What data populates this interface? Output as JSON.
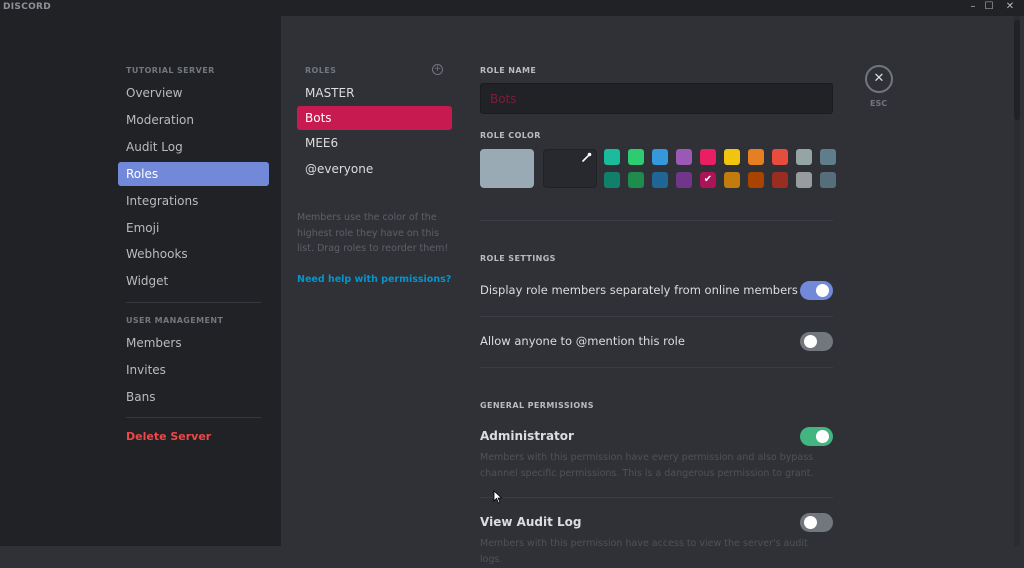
{
  "titlebar": {
    "app_name": "DISCORD",
    "minimize": "–",
    "maximize": "☐",
    "close": "✕"
  },
  "sidebar": {
    "server_header": "TUTORIAL SERVER",
    "server_items": [
      {
        "label": "Overview",
        "active": false
      },
      {
        "label": "Moderation",
        "active": false
      },
      {
        "label": "Audit Log",
        "active": false
      },
      {
        "label": "Roles",
        "active": true
      },
      {
        "label": "Integrations",
        "active": false
      },
      {
        "label": "Emoji",
        "active": false
      },
      {
        "label": "Webhooks",
        "active": false
      },
      {
        "label": "Widget",
        "active": false
      }
    ],
    "user_header": "USER MANAGEMENT",
    "user_items": [
      {
        "label": "Members"
      },
      {
        "label": "Invites"
      },
      {
        "label": "Bans"
      }
    ],
    "delete_label": "Delete Server"
  },
  "roles": {
    "header": "ROLES",
    "add_icon": "+",
    "items": [
      {
        "label": "MASTER",
        "active": false
      },
      {
        "label": "Bots",
        "active": true
      },
      {
        "label": "MEE6",
        "active": false
      },
      {
        "label": "@everyone",
        "active": false
      }
    ],
    "help_text": "Members use the color of the highest role they have on this list. Drag roles to reorder them!",
    "help_link": "Need help with permissions?"
  },
  "editor": {
    "role_name_label": "ROLE NAME",
    "role_name_value": "Bots",
    "role_color_label": "ROLE COLOR",
    "default_color": "#99aab5",
    "swatches_row1": [
      "#1abc9c",
      "#2ecc71",
      "#3498db",
      "#9b59b6",
      "#e91e63",
      "#f1c40f",
      "#e67e22",
      "#e74c3c",
      "#95a5a6",
      "#607d8b"
    ],
    "swatches_row2": [
      "#11806a",
      "#1f8b4c",
      "#206694",
      "#71368a",
      "#ad1457",
      "#c27c0e",
      "#a84300",
      "#992d22",
      "#979c9f",
      "#546e7a"
    ],
    "selected_swatch": {
      "row": 2,
      "index": 4
    },
    "check_glyph": "✔",
    "role_settings_label": "ROLE SETTINGS",
    "settings": [
      {
        "label": "Display role members separately from online members",
        "enabled": true
      },
      {
        "label": "Allow anyone to @mention this role",
        "enabled": false
      }
    ],
    "general_permissions_label": "GENERAL PERMISSIONS",
    "permissions": [
      {
        "label": "Administrator",
        "description": "Members with this permission have every permission and also bypass channel specific permissions. This is a dangerous permission to grant.",
        "enabled": true
      },
      {
        "label": "View Audit Log",
        "description": "Members with this permission have access to view the server's audit logs.",
        "enabled": false
      }
    ]
  },
  "close": {
    "icon": "✕",
    "label": "ESC"
  },
  "colors": {
    "blurple": "#7289da",
    "toggle_on_blue": "#7289da",
    "toggle_on_green": "#43b581",
    "toggle_off": "#72767d",
    "danger": "#f04747",
    "role_active": "#c61a50",
    "link": "#0096cf"
  }
}
